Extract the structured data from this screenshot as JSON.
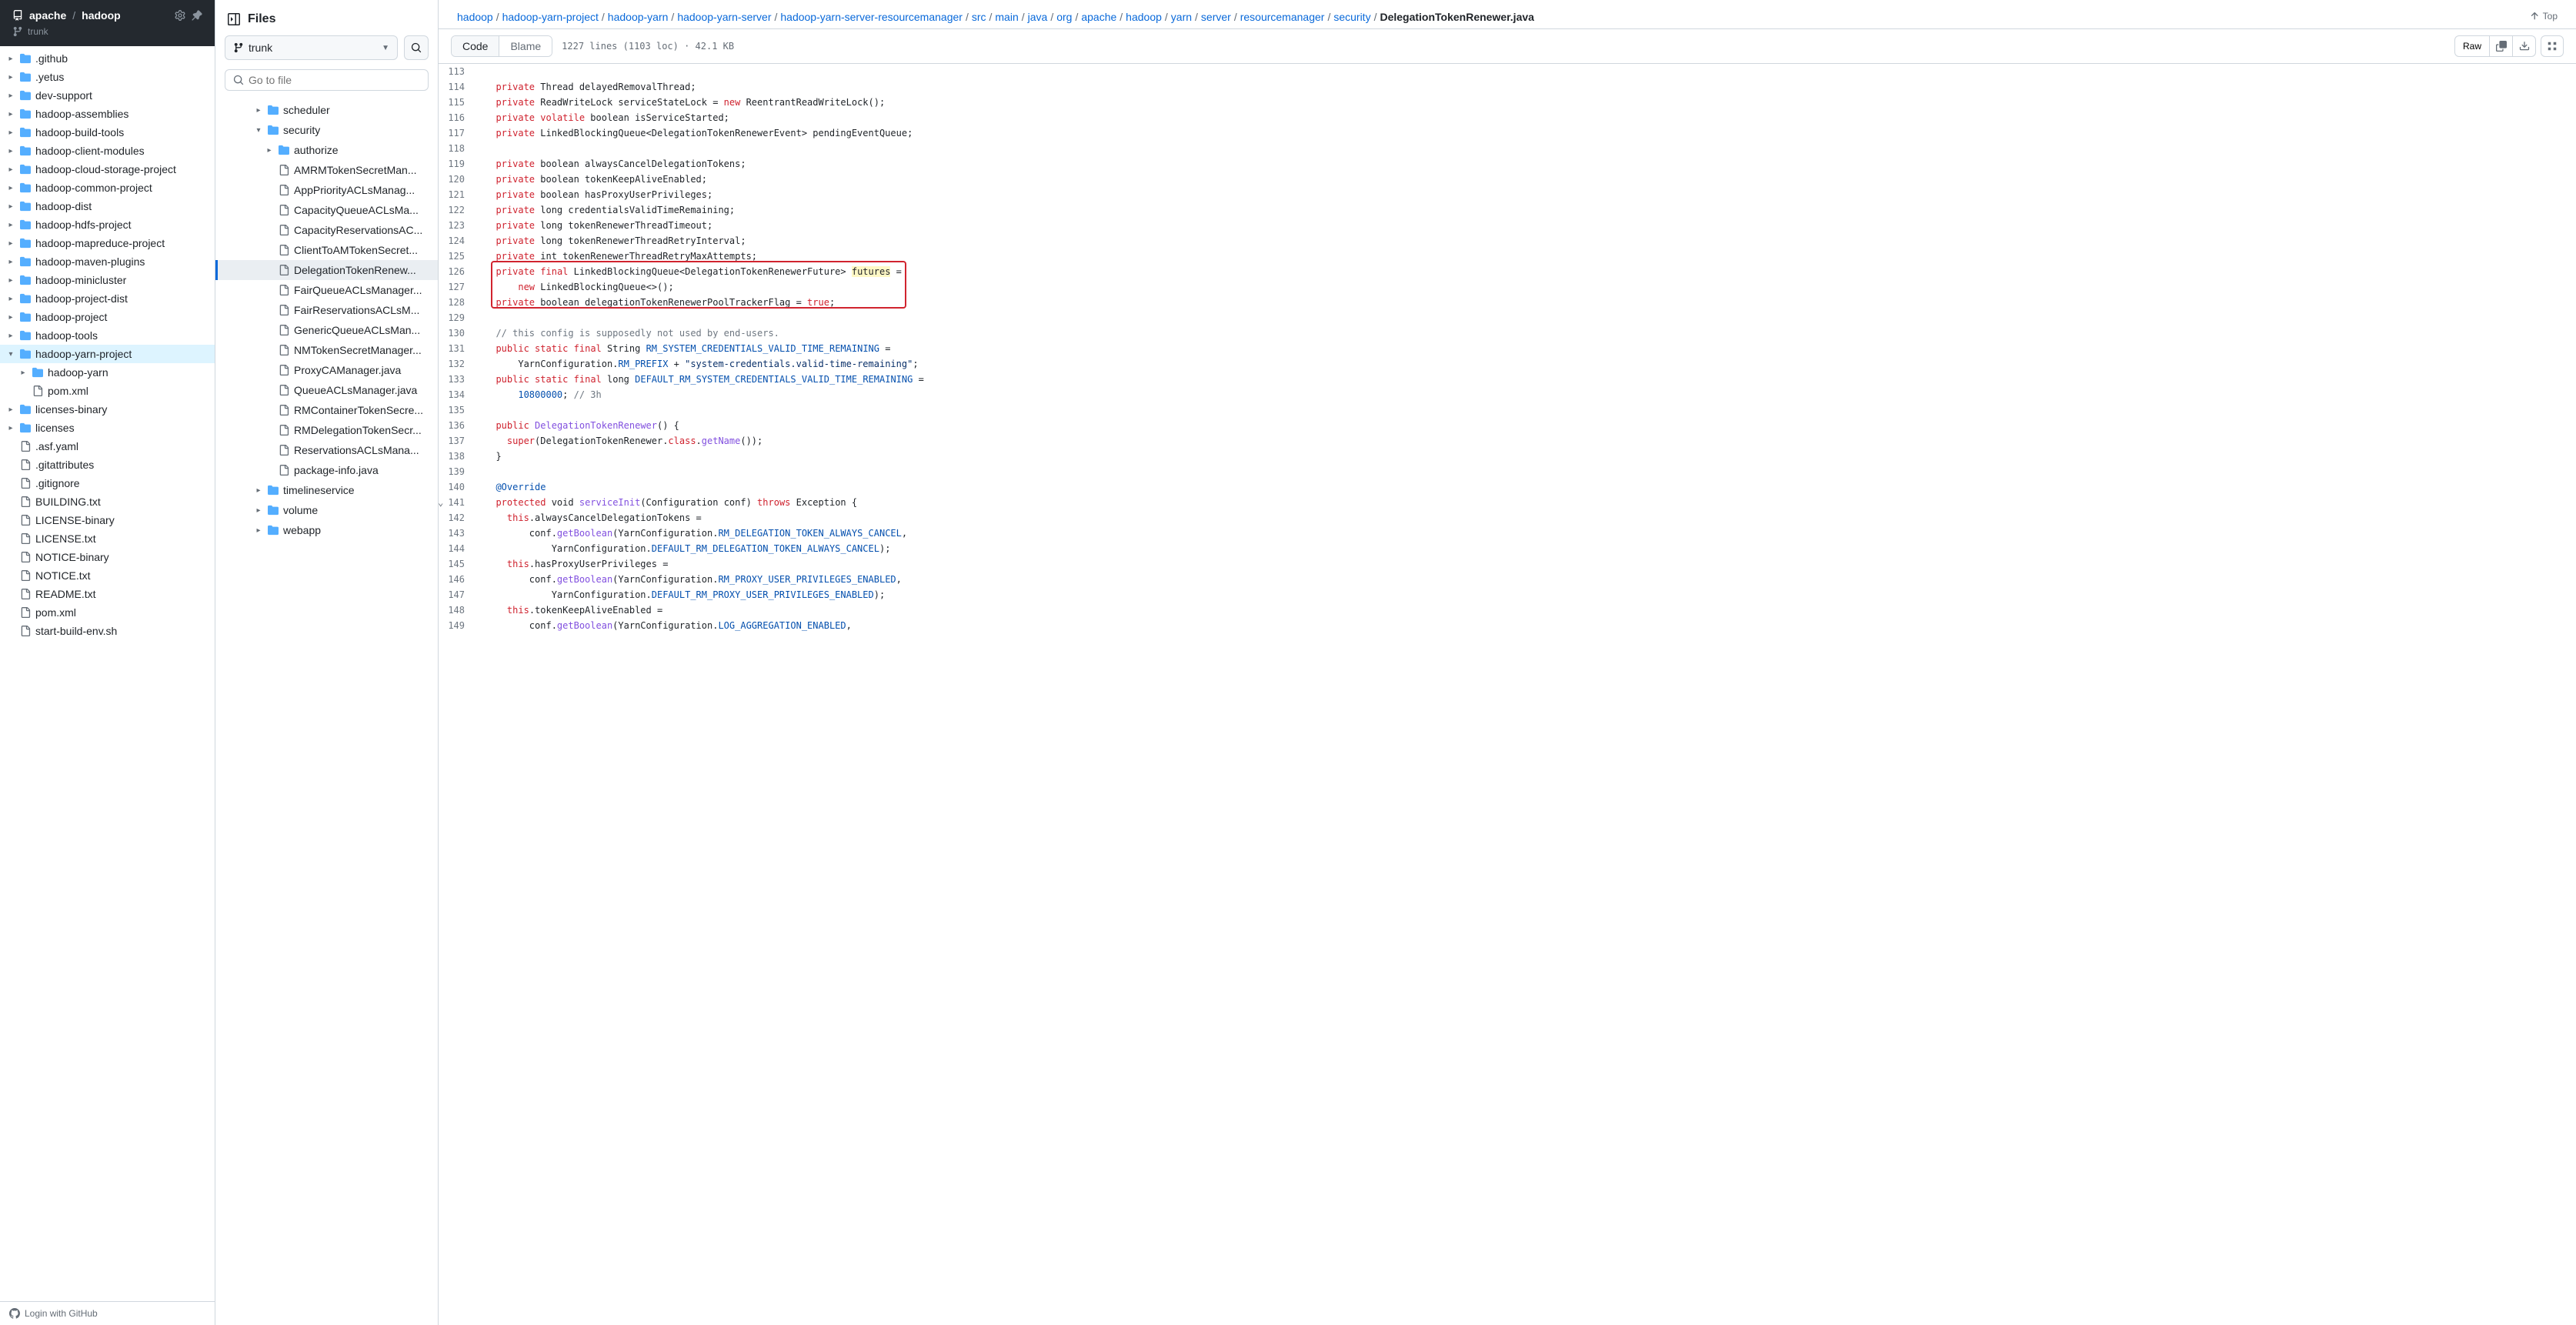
{
  "repo": {
    "owner": "apache",
    "name": "hadoop",
    "branch": "trunk"
  },
  "repoTree": [
    {
      "type": "folder",
      "name": ".github",
      "indent": 0,
      "chev": "right"
    },
    {
      "type": "folder",
      "name": ".yetus",
      "indent": 0,
      "chev": "right"
    },
    {
      "type": "folder",
      "name": "dev-support",
      "indent": 0,
      "chev": "right"
    },
    {
      "type": "folder",
      "name": "hadoop-assemblies",
      "indent": 0,
      "chev": "right"
    },
    {
      "type": "folder",
      "name": "hadoop-build-tools",
      "indent": 0,
      "chev": "right"
    },
    {
      "type": "folder",
      "name": "hadoop-client-modules",
      "indent": 0,
      "chev": "right"
    },
    {
      "type": "folder",
      "name": "hadoop-cloud-storage-project",
      "indent": 0,
      "chev": "right"
    },
    {
      "type": "folder",
      "name": "hadoop-common-project",
      "indent": 0,
      "chev": "right"
    },
    {
      "type": "folder",
      "name": "hadoop-dist",
      "indent": 0,
      "chev": "right"
    },
    {
      "type": "folder",
      "name": "hadoop-hdfs-project",
      "indent": 0,
      "chev": "right"
    },
    {
      "type": "folder",
      "name": "hadoop-mapreduce-project",
      "indent": 0,
      "chev": "right"
    },
    {
      "type": "folder",
      "name": "hadoop-maven-plugins",
      "indent": 0,
      "chev": "right"
    },
    {
      "type": "folder",
      "name": "hadoop-minicluster",
      "indent": 0,
      "chev": "right"
    },
    {
      "type": "folder",
      "name": "hadoop-project-dist",
      "indent": 0,
      "chev": "right"
    },
    {
      "type": "folder",
      "name": "hadoop-project",
      "indent": 0,
      "chev": "right"
    },
    {
      "type": "folder",
      "name": "hadoop-tools",
      "indent": 0,
      "chev": "right"
    },
    {
      "type": "folder",
      "name": "hadoop-yarn-project",
      "indent": 0,
      "chev": "down",
      "active": true
    },
    {
      "type": "folder",
      "name": "hadoop-yarn",
      "indent": 1,
      "chev": "right"
    },
    {
      "type": "file",
      "name": "pom.xml",
      "indent": 1
    },
    {
      "type": "folder",
      "name": "licenses-binary",
      "indent": 0,
      "chev": "right"
    },
    {
      "type": "folder",
      "name": "licenses",
      "indent": 0,
      "chev": "right"
    },
    {
      "type": "file",
      "name": ".asf.yaml",
      "indent": 0
    },
    {
      "type": "file",
      "name": ".gitattributes",
      "indent": 0
    },
    {
      "type": "file",
      "name": ".gitignore",
      "indent": 0
    },
    {
      "type": "file",
      "name": "BUILDING.txt",
      "indent": 0
    },
    {
      "type": "file",
      "name": "LICENSE-binary",
      "indent": 0
    },
    {
      "type": "file",
      "name": "LICENSE.txt",
      "indent": 0
    },
    {
      "type": "file",
      "name": "NOTICE-binary",
      "indent": 0
    },
    {
      "type": "file",
      "name": "NOTICE.txt",
      "indent": 0
    },
    {
      "type": "file",
      "name": "README.txt",
      "indent": 0
    },
    {
      "type": "file",
      "name": "pom.xml",
      "indent": 0
    },
    {
      "type": "file",
      "name": "start-build-env.sh",
      "indent": 0
    }
  ],
  "fileExplorer": {
    "title": "Files",
    "branch": "trunk",
    "searchPlaceholder": "Go to file",
    "items": [
      {
        "type": "folder",
        "name": "scheduler",
        "indent": 3,
        "chev": "right"
      },
      {
        "type": "folder",
        "name": "security",
        "indent": 3,
        "chev": "down"
      },
      {
        "type": "folder",
        "name": "authorize",
        "indent": 4,
        "chev": "right"
      },
      {
        "type": "file",
        "name": "AMRMTokenSecretMan...",
        "indent": 4
      },
      {
        "type": "file",
        "name": "AppPriorityACLsManag...",
        "indent": 4
      },
      {
        "type": "file",
        "name": "CapacityQueueACLsMa...",
        "indent": 4
      },
      {
        "type": "file",
        "name": "CapacityReservationsAC...",
        "indent": 4
      },
      {
        "type": "file",
        "name": "ClientToAMTokenSecret...",
        "indent": 4
      },
      {
        "type": "file",
        "name": "DelegationTokenRenew...",
        "indent": 4,
        "selected": true
      },
      {
        "type": "file",
        "name": "FairQueueACLsManager...",
        "indent": 4
      },
      {
        "type": "file",
        "name": "FairReservationsACLsM...",
        "indent": 4
      },
      {
        "type": "file",
        "name": "GenericQueueACLsMan...",
        "indent": 4
      },
      {
        "type": "file",
        "name": "NMTokenSecretManager...",
        "indent": 4
      },
      {
        "type": "file",
        "name": "ProxyCAManager.java",
        "indent": 4
      },
      {
        "type": "file",
        "name": "QueueACLsManager.java",
        "indent": 4
      },
      {
        "type": "file",
        "name": "RMContainerTokenSecre...",
        "indent": 4
      },
      {
        "type": "file",
        "name": "RMDelegationTokenSecr...",
        "indent": 4
      },
      {
        "type": "file",
        "name": "ReservationsACLsMana...",
        "indent": 4
      },
      {
        "type": "file",
        "name": "package-info.java",
        "indent": 4
      },
      {
        "type": "folder",
        "name": "timelineservice",
        "indent": 3,
        "chev": "right"
      },
      {
        "type": "folder",
        "name": "volume",
        "indent": 3,
        "chev": "right"
      },
      {
        "type": "folder",
        "name": "webapp",
        "indent": 3,
        "chev": "right"
      }
    ]
  },
  "breadcrumb": [
    "hadoop",
    "hadoop-yarn-project",
    "hadoop-yarn",
    "hadoop-yarn-server",
    "hadoop-yarn-server-resourcemanager",
    "src",
    "main",
    "java",
    "org",
    "apache",
    "hadoop",
    "yarn",
    "server",
    "resourcemanager",
    "security",
    "DelegationTokenRenewer.java"
  ],
  "topLabel": "Top",
  "tabs": {
    "code": "Code",
    "blame": "Blame"
  },
  "fileInfo": "1227 lines (1103 loc) · 42.1 KB",
  "rawLabel": "Raw",
  "footer": "Login with GitHub",
  "code": [
    {
      "n": 113,
      "html": ""
    },
    {
      "n": 114,
      "html": "  <span class='kw'>private</span> Thread delayedRemovalThread;"
    },
    {
      "n": 115,
      "html": "  <span class='kw'>private</span> ReadWriteLock serviceStateLock = <span class='kw'>new</span> ReentrantReadWriteLock();"
    },
    {
      "n": 116,
      "html": "  <span class='kw'>private</span> <span class='kw'>volatile</span> boolean isServiceStarted;"
    },
    {
      "n": 117,
      "html": "  <span class='kw'>private</span> LinkedBlockingQueue&lt;DelegationTokenRenewerEvent&gt; pendingEventQueue;"
    },
    {
      "n": 118,
      "html": ""
    },
    {
      "n": 119,
      "html": "  <span class='kw'>private</span> boolean alwaysCancelDelegationTokens;"
    },
    {
      "n": 120,
      "html": "  <span class='kw'>private</span> boolean tokenKeepAliveEnabled;"
    },
    {
      "n": 121,
      "html": "  <span class='kw'>private</span> boolean hasProxyUserPrivileges;"
    },
    {
      "n": 122,
      "html": "  <span class='kw'>private</span> long credentialsValidTimeRemaining;"
    },
    {
      "n": 123,
      "html": "  <span class='kw'>private</span> long tokenRenewerThreadTimeout;"
    },
    {
      "n": 124,
      "html": "  <span class='kw'>private</span> long tokenRenewerThreadRetryInterval;"
    },
    {
      "n": 125,
      "html": "  <span class='kw'>private</span> int tokenRenewerThreadRetryMaxAttempts;"
    },
    {
      "n": 126,
      "html": "  <span class='kw'>private</span> <span class='kw'>final</span> LinkedBlockingQueue&lt;DelegationTokenRenewerFuture&gt; <span class='hl-word'>futures</span> ="
    },
    {
      "n": 127,
      "html": "      <span class='kw'>new</span> LinkedBlockingQueue&lt;&gt;();"
    },
    {
      "n": 128,
      "html": "  <span class='kw'>private</span> boolean delegationTokenRenewerPoolTrackerFlag = <span class='kw'>true</span>;"
    },
    {
      "n": 129,
      "html": ""
    },
    {
      "n": 130,
      "html": "  <span class='cmt'>// this config is supposedly not used by end-users.</span>"
    },
    {
      "n": 131,
      "html": "  <span class='kw'>public</span> <span class='kw'>static</span> <span class='kw'>final</span> String <span class='const'>RM_SYSTEM_CREDENTIALS_VALID_TIME_REMAINING</span> ="
    },
    {
      "n": 132,
      "html": "      YarnConfiguration.<span class='const'>RM_PREFIX</span> + <span class='str'>\"system-credentials.valid-time-remaining\"</span>;"
    },
    {
      "n": 133,
      "html": "  <span class='kw'>public</span> <span class='kw'>static</span> <span class='kw'>final</span> long <span class='const'>DEFAULT_RM_SYSTEM_CREDENTIALS_VALID_TIME_REMAINING</span> ="
    },
    {
      "n": 134,
      "html": "      <span class='num'>10800000</span>; <span class='cmt'>// 3h</span>"
    },
    {
      "n": 135,
      "html": ""
    },
    {
      "n": 136,
      "html": "  <span class='kw'>public</span> <span class='fn'>DelegationTokenRenewer</span>() {"
    },
    {
      "n": 137,
      "html": "    <span class='kw'>super</span>(DelegationTokenRenewer.<span class='kw'>class</span>.<span class='fn'>getName</span>());"
    },
    {
      "n": 138,
      "html": "  }"
    },
    {
      "n": 139,
      "html": ""
    },
    {
      "n": 140,
      "html": "  <span class='const'>@Override</span>"
    },
    {
      "n": 141,
      "html": "  <span class='kw'>protected</span> void <span class='fn'>serviceInit</span>(Configuration conf) <span class='kw'>throws</span> Exception {",
      "expand": true
    },
    {
      "n": 142,
      "html": "    <span class='kw'>this</span>.alwaysCancelDelegationTokens ="
    },
    {
      "n": 143,
      "html": "        conf.<span class='fn'>getBoolean</span>(YarnConfiguration.<span class='const'>RM_DELEGATION_TOKEN_ALWAYS_CANCEL</span>,"
    },
    {
      "n": 144,
      "html": "            YarnConfiguration.<span class='const'>DEFAULT_RM_DELEGATION_TOKEN_ALWAYS_CANCEL</span>);"
    },
    {
      "n": 145,
      "html": "    <span class='kw'>this</span>.hasProxyUserPrivileges ="
    },
    {
      "n": 146,
      "html": "        conf.<span class='fn'>getBoolean</span>(YarnConfiguration.<span class='const'>RM_PROXY_USER_PRIVILEGES_ENABLED</span>,"
    },
    {
      "n": 147,
      "html": "            YarnConfiguration.<span class='const'>DEFAULT_RM_PROXY_USER_PRIVILEGES_ENABLED</span>);"
    },
    {
      "n": 148,
      "html": "    <span class='kw'>this</span>.tokenKeepAliveEnabled ="
    },
    {
      "n": 149,
      "html": "        conf.<span class='fn'>getBoolean</span>(YarnConfiguration.<span class='const'>LOG_AGGREGATION_ENABLED</span>,"
    }
  ],
  "redBox": {
    "startLine": 126,
    "endLine": 128
  }
}
